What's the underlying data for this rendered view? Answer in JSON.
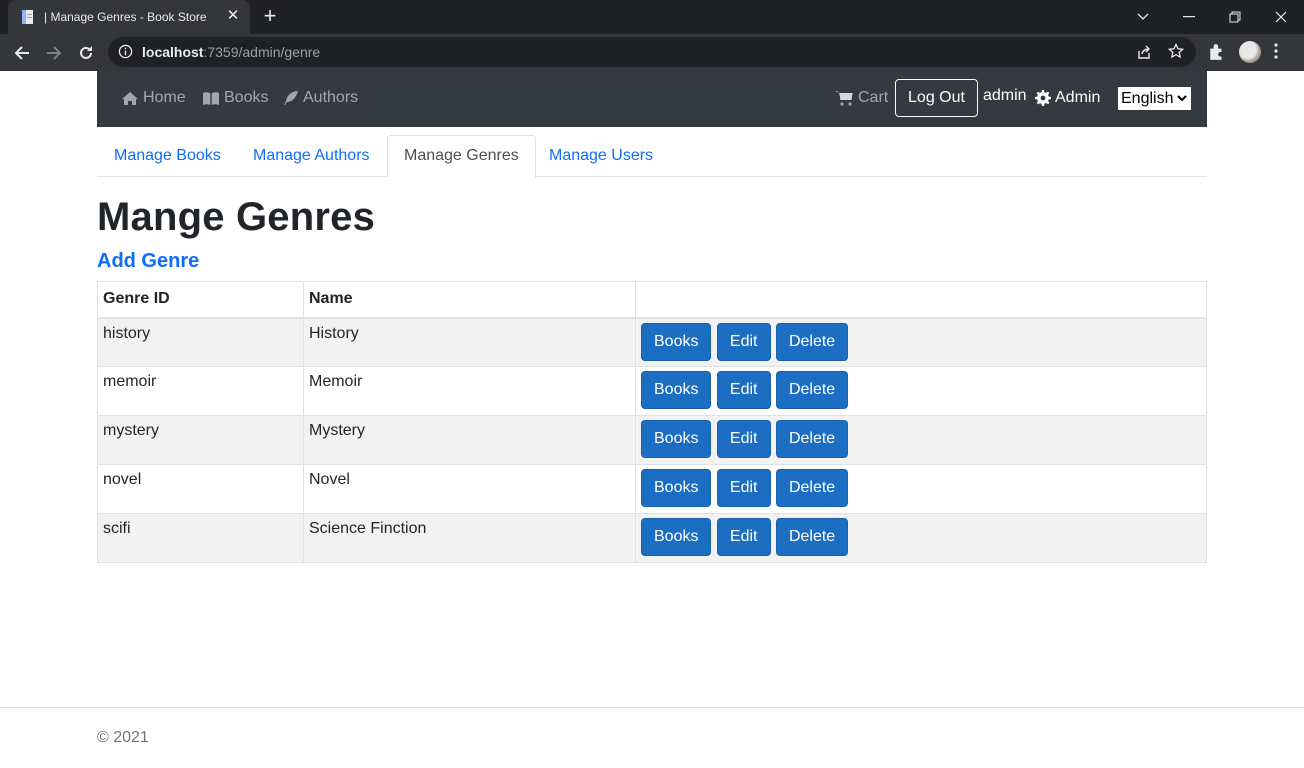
{
  "browser": {
    "tab_title": "| Manage Genres - Book Store",
    "url_host": "localhost",
    "url_path": ":7359/admin/genre"
  },
  "navbar": {
    "links": [
      {
        "label": "Home",
        "icon": "home-icon"
      },
      {
        "label": "Books",
        "icon": "book-open-icon"
      },
      {
        "label": "Authors",
        "icon": "feather-icon"
      }
    ],
    "cart_label": "Cart",
    "logout_label": "Log Out",
    "username": "admin",
    "admin_label": "Admin",
    "language": "English"
  },
  "tabs": [
    {
      "label": "Manage Books",
      "active": false
    },
    {
      "label": "Manage Authors",
      "active": false
    },
    {
      "label": "Manage Genres",
      "active": true
    },
    {
      "label": "Manage Users",
      "active": false
    }
  ],
  "main": {
    "title": "Mange Genres",
    "add_label": "Add Genre",
    "table": {
      "headers": [
        "Genre ID",
        "Name",
        ""
      ],
      "rows": [
        {
          "id": "history",
          "name": "History"
        },
        {
          "id": "memoir",
          "name": "Memoir"
        },
        {
          "id": "mystery",
          "name": "Mystery"
        },
        {
          "id": "novel",
          "name": "Novel"
        },
        {
          "id": "scifi",
          "name": "Science Finction"
        }
      ],
      "actions": {
        "books": "Books",
        "edit": "Edit",
        "delete": "Delete"
      }
    }
  },
  "footer": {
    "text": "© 2021"
  },
  "colors": {
    "navbar_bg": "#343a40",
    "primary_button": "#1b6ec2",
    "link": "#0d6efd"
  }
}
